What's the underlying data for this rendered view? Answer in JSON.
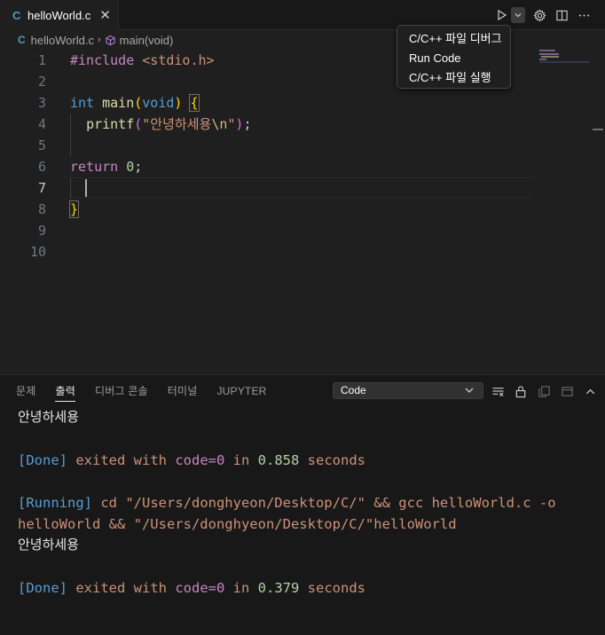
{
  "tab": {
    "file_icon": "C",
    "filename": "helloWorld.c",
    "close_glyph": "✕"
  },
  "toolbar": {
    "run_icon": "play-icon",
    "dropdown_icon": "chevron-down-icon",
    "settings_icon": "gear-icon",
    "split_icon": "split-editor-icon",
    "more_icon": "ellipsis-icon"
  },
  "breadcrumb": {
    "file_icon": "C",
    "file": "helloWorld.c",
    "sep": "›",
    "symbol": "main(void)"
  },
  "editor": {
    "line_numbers": [
      "1",
      "2",
      "3",
      "4",
      "5",
      "6",
      "7",
      "8",
      "9",
      "10"
    ],
    "active_line": "7",
    "line1": {
      "directive": "#include",
      "header": "<stdio.h>"
    },
    "line3": {
      "type": "int",
      "name": "main",
      "open_paren": "(",
      "param": "void",
      "close_paren": ")",
      "brace": "{"
    },
    "line4": {
      "indent": "  ",
      "func": "printf",
      "open_paren": "(",
      "str_open": "\"안녕하세용",
      "escape": "\\n",
      "str_close": "\"",
      "close_paren": ")",
      "semi": ";"
    },
    "line6": {
      "keyword": "return",
      "value": "0",
      "semi": ";"
    },
    "line8": {
      "brace": "}"
    }
  },
  "run_menu": {
    "items": [
      "C/C++ 파일 디버그",
      "Run Code",
      "C/C++ 파일 실행"
    ]
  },
  "panel": {
    "tabs": [
      "문제",
      "출력",
      "디버그 콘솔",
      "터미널",
      "JUPYTER"
    ],
    "active_tab": "출력",
    "output_channel": "Code",
    "actions": [
      "filter-list-icon",
      "lock-icon",
      "copy-icon",
      "maximize-icon",
      "chevron-up-icon",
      "close-icon"
    ]
  },
  "output": {
    "line1": "안녕하세용",
    "done1": {
      "tag": "[Done]",
      "text1": " exited with ",
      "code": "code=0",
      "text2": " in ",
      "time": "0.858",
      "text3": " seconds"
    },
    "running": {
      "tag": "[Running]",
      "cmd1": " cd \"/Users/donghyeon/Desktop/C/\" && gcc helloWorld.c -o",
      "cmd2": "helloWorld && \"/Users/donghyeon/Desktop/C/\"helloWorld"
    },
    "line2": "안녕하세용",
    "done2": {
      "tag": "[Done]",
      "text1": " exited with ",
      "code": "code=0",
      "text2": " in ",
      "time": "0.379",
      "text3": " seconds"
    }
  }
}
